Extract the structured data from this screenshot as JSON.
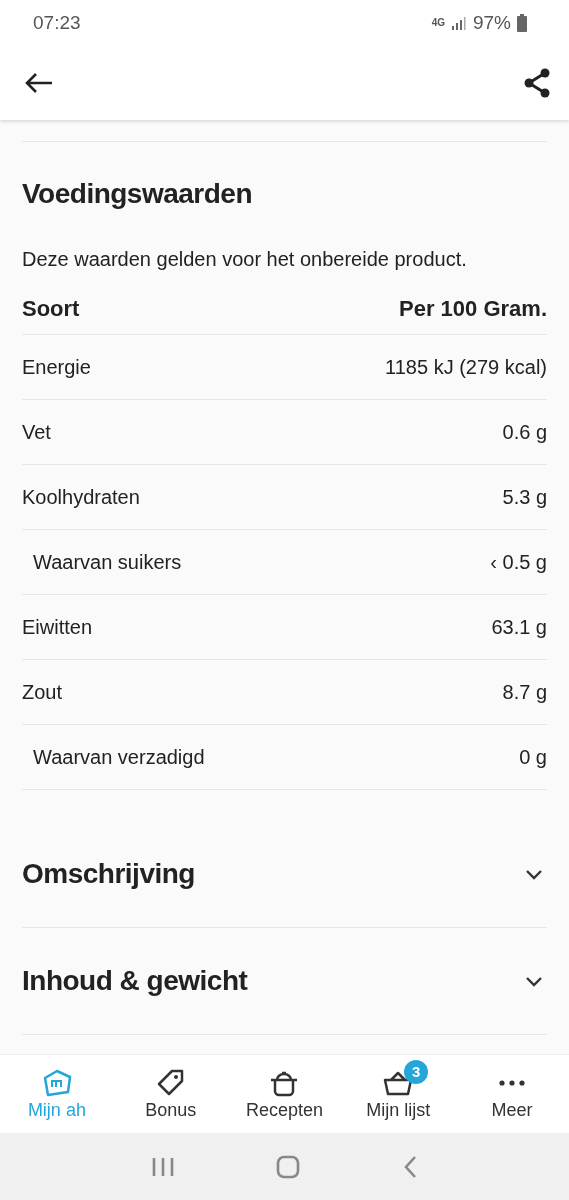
{
  "status_bar": {
    "time": "07:23",
    "network": "4G",
    "battery": "97%"
  },
  "section": {
    "title": "Voedingswaarden",
    "note": "Deze waarden gelden voor het onbereide product."
  },
  "table": {
    "columns": [
      "Soort",
      "Per 100 Gram."
    ],
    "rows": [
      {
        "kind": "main",
        "name": "Energie",
        "value": "1185 kJ (279 kcal)"
      },
      {
        "kind": "main",
        "name": "Vet",
        "value": "0.6 g"
      },
      {
        "kind": "main",
        "name": "Koolhydraten",
        "value": "5.3 g"
      },
      {
        "kind": "sub",
        "name": "Waarvan suikers",
        "value": "‹ 0.5 g"
      },
      {
        "kind": "main",
        "name": "Eiwitten",
        "value": "63.1 g"
      },
      {
        "kind": "main",
        "name": "Zout",
        "value": "8.7 g"
      },
      {
        "kind": "sub",
        "name": "Waarvan verzadigd",
        "value": "0 g"
      }
    ]
  },
  "collapsibles": [
    {
      "title": "Omschrijving",
      "expanded": false
    },
    {
      "title": "Inhoud & gewicht",
      "expanded": false
    }
  ],
  "bottom_nav": [
    {
      "kind": "home",
      "label": "Mijn ah",
      "selected": true
    },
    {
      "kind": "tag",
      "label": "Bonus",
      "selected": false
    },
    {
      "kind": "pot",
      "label": "Recepten",
      "selected": false
    },
    {
      "kind": "basket",
      "label": "Mijn lijst",
      "selected": false,
      "badge": "3"
    },
    {
      "kind": "more",
      "label": "Meer",
      "selected": false
    }
  ]
}
